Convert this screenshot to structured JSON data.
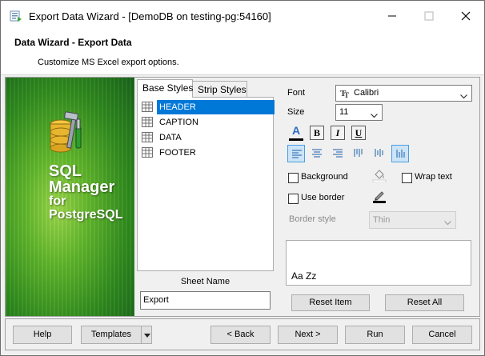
{
  "window": {
    "title": "Export Data Wizard - [DemoDB on testing-pg:54160]",
    "minimize": "minimize",
    "maximize": "maximize",
    "close": "close"
  },
  "header": {
    "title": "Data Wizard - Export Data",
    "subtitle": "Customize MS Excel export options."
  },
  "banner": {
    "line1": "SQL",
    "line2": "Manager",
    "line3": "for",
    "line4": "PostgreSQL"
  },
  "tabs": [
    {
      "label": "Base Styles",
      "active": true
    },
    {
      "label": "Strip Styles",
      "active": false
    }
  ],
  "style_items": [
    {
      "label": "HEADER",
      "selected": true
    },
    {
      "label": "CAPTION",
      "selected": false
    },
    {
      "label": "DATA",
      "selected": false
    },
    {
      "label": "FOOTER",
      "selected": false
    }
  ],
  "sheet": {
    "label": "Sheet Name",
    "value": "Export"
  },
  "font": {
    "label": "Font",
    "value": "Calibri"
  },
  "size": {
    "label": "Size",
    "value": "11"
  },
  "format": {
    "color_glyph": "A",
    "bold": "B",
    "italic": "I",
    "underline": "U"
  },
  "options": {
    "background_label": "Background",
    "wrap_text_label": "Wrap text",
    "use_border_label": "Use border",
    "border_style_label": "Border style",
    "border_style_value": "Thin"
  },
  "preview": {
    "text": "Aa Zz"
  },
  "buttons": {
    "reset_item": "Reset Item",
    "reset_all": "Reset All",
    "help": "Help",
    "templates": "Templates",
    "back": "< Back",
    "next": "Next >",
    "run": "Run",
    "cancel": "Cancel"
  },
  "colors": {
    "selection": "#0078d7",
    "banner_green": "#2f8a1d",
    "align_active": "#cce4f7"
  }
}
